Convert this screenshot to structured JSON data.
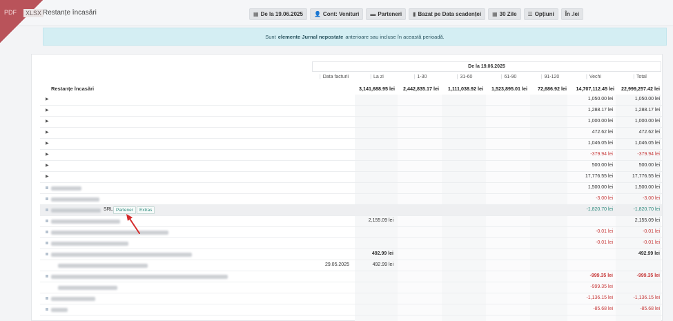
{
  "header": {
    "pdf_label": "PDF",
    "xlsx_label": "XLSX",
    "title": "Restanțe încasări"
  },
  "toolbar": [
    {
      "icon": "calendar-icon",
      "glyph": "▦",
      "label": "De la 19.06.2025"
    },
    {
      "icon": "user-icon",
      "glyph": "👤",
      "label": "Cont: Venituri"
    },
    {
      "icon": "folder-icon",
      "glyph": "▬",
      "label": "Parteneri"
    },
    {
      "icon": "document-icon",
      "glyph": "▮",
      "label": "Bazat pe Data scadenței"
    },
    {
      "icon": "calendar-icon",
      "glyph": "▦",
      "label": "30 Zile"
    },
    {
      "icon": "sliders-icon",
      "glyph": "☰",
      "label": "Opțiuni"
    },
    {
      "icon": "",
      "glyph": "",
      "label": "În .lei"
    }
  ],
  "banner": {
    "prefix": "Sunt",
    "bold": "elemente Jurnal nepostate",
    "suffix": "anterioare sau incluse în această perioadă."
  },
  "table": {
    "group_header": "De la 19.06.2025",
    "columns": [
      "Data facturii",
      "La zi",
      "1-30",
      "31-60",
      "61-90",
      "91-120",
      "Vechi",
      "Total"
    ],
    "totals_label": "Restanțe încasări",
    "totals": [
      "",
      "3,141,688.95 lei",
      "2,442,835.17 lei",
      "1,111,038.92 lei",
      "1,523,895.01 lei",
      "72,686.92 lei",
      "14,707,112.45 lei",
      "22,999,257.42 lei"
    ],
    "rows": [
      {
        "vechi": "1,050.00 lei",
        "total": "1,050.00 lei"
      },
      {
        "vechi": "1,288.17 lei",
        "total": "1,288.17 lei"
      },
      {
        "vechi": "1,000.00 lei",
        "total": "1,000.00 lei"
      },
      {
        "vechi": "472.62 lei",
        "total": "472.62 lei"
      },
      {
        "vechi": "1,046.05 lei",
        "total": "1,046.05 lei"
      },
      {
        "vechi": "-379.94 lei",
        "total": "-379.94 lei"
      },
      {
        "vechi": "500.00 lei",
        "total": "500.00 lei"
      },
      {
        "vechi": "17,776.55 lei",
        "total": "17,776.55 lei"
      },
      {
        "vechi": "1,500.00 lei",
        "total": "1,500.00 lei"
      },
      {
        "vechi": "-3.00 lei",
        "total": "-3.00 lei"
      },
      {
        "name_suffix": "SRL",
        "partner_label": "Partener",
        "extras_label": "Extras",
        "vechi": "-1,820.70 lei",
        "total": "-1,820.70 lei"
      },
      {
        "lazi": "2,155.09 lei",
        "total": "2,155.09 lei"
      },
      {
        "vechi": "-0.01 lei",
        "total": "-0.01 lei"
      },
      {
        "vechi": "-0.01 lei",
        "total": "-0.01 lei"
      },
      {
        "lazi": "492.99 lei",
        "total": "492.99 lei"
      },
      {
        "date": "29.05.2025",
        "lazi": "492.99 lei"
      },
      {
        "vechi": "-999.35 lei",
        "total": "-999.35 lei"
      },
      {
        "vechi": "-999.35 lei"
      },
      {
        "vechi": "-1,136.15 lei",
        "total": "-1,136.15 lei"
      },
      {
        "vechi": "-85.68 lei",
        "total": "-85.68 lei"
      }
    ]
  },
  "colors": {
    "accent_red": "#b9535a",
    "negative": "#c73a3a",
    "teal": "#2d8a7d",
    "banner_bg": "#d4eef3"
  }
}
